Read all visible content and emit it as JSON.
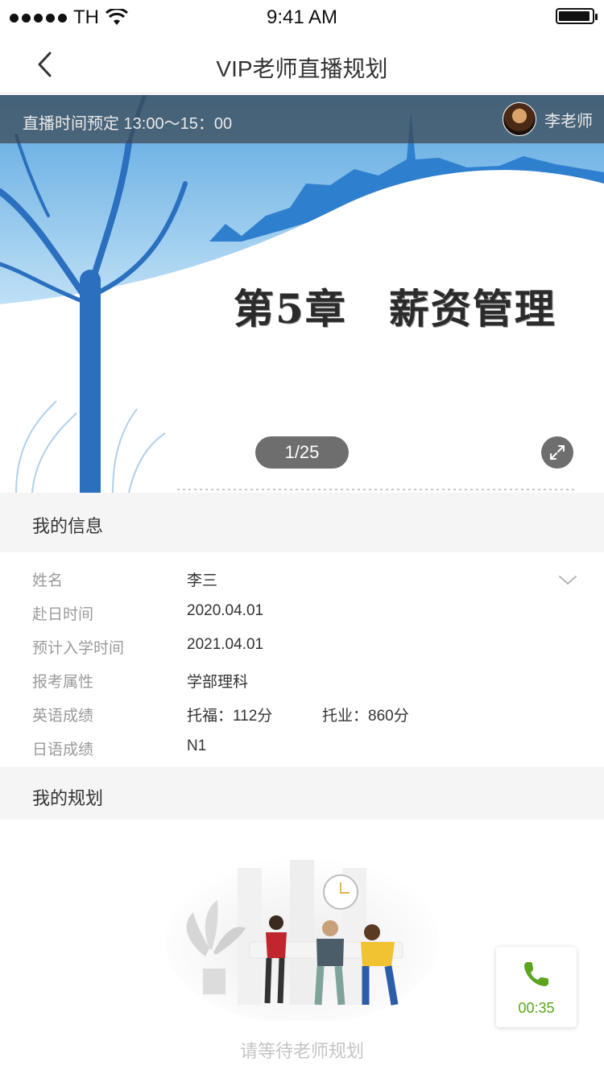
{
  "status_bar": {
    "carrier": "TH",
    "time": "9:41 AM",
    "battery_level": 0.95
  },
  "nav": {
    "title": "VIP老师直播规划",
    "back_icon": "chevron-left-icon"
  },
  "live": {
    "schedule_text": "直播时间预定 13:00～15：00",
    "teacher_name": "李老师",
    "slide_title": "第5章　薪资管理",
    "page_indicator": "1/25",
    "fullscreen_icon": "expand-icon"
  },
  "my_info": {
    "heading": "我的信息",
    "rows": [
      {
        "label": "姓名",
        "value": "李三"
      },
      {
        "label": "赴日时间",
        "value": "2020.04.01"
      },
      {
        "label": "预计入学时间",
        "value": "2021.04.01"
      },
      {
        "label": "报考属性",
        "value": "学部理科"
      },
      {
        "label": "英语成绩",
        "value": "托福：112分",
        "value2": "托业：860分"
      },
      {
        "label": "日语成绩",
        "value": "N1"
      }
    ],
    "collapse_icon": "chevron-down-icon"
  },
  "my_plan": {
    "heading": "我的规划",
    "empty_text": "请等待老师规划"
  },
  "call": {
    "timer": "00:35",
    "icon": "phone-icon"
  },
  "colors": {
    "accent_green": "#5aa51d",
    "section_bg": "#f5f5f5",
    "label_gray": "#9a9a9a"
  }
}
